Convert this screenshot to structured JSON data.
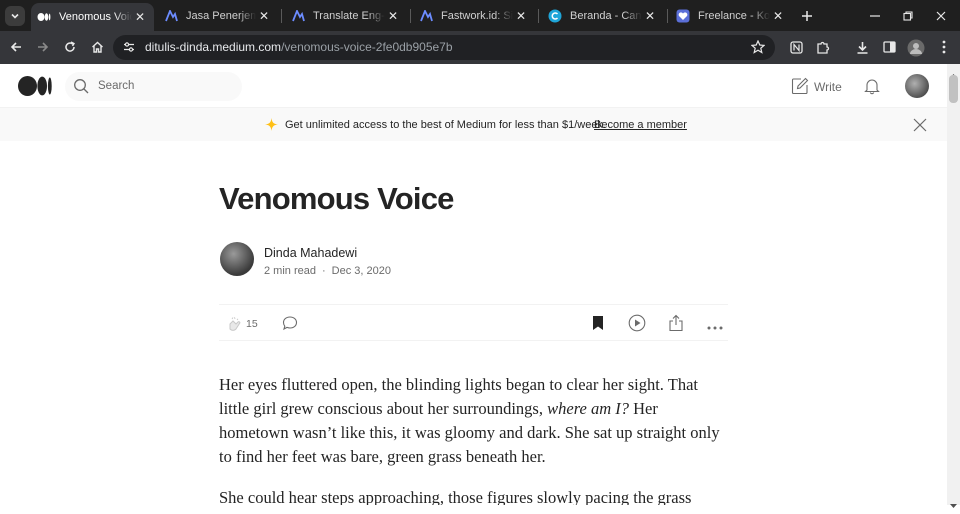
{
  "browser": {
    "tabs": [
      {
        "title": "Venomous Voice. Her eyes fluttered",
        "favicon": "medium-icon",
        "active": true
      },
      {
        "title": "Jasa Penerjemah & Translator",
        "favicon": "fastwork-icon",
        "active": false
      },
      {
        "title": "Translate Eng-Indo",
        "favicon": "fastwork-icon",
        "active": false
      },
      {
        "title": "Fastwork.id: Situs Freelance",
        "favicon": "fastwork-icon",
        "active": false
      },
      {
        "title": "Beranda - Canva",
        "favicon": "canva-icon",
        "active": false
      },
      {
        "title": "Freelance - Konten",
        "favicon": "heart-icon",
        "active": false
      }
    ],
    "url_host": "ditulis-dinda.medium.com",
    "url_path": "/venomous-voice-2fe0db905e7b"
  },
  "medium": {
    "search_placeholder": "Search",
    "write_label": "Write"
  },
  "banner": {
    "text": "Get unlimited access to the best of Medium for less than $1/week.",
    "link": "Become a member"
  },
  "article": {
    "title": "Venomous Voice",
    "author": "Dinda Mahadewi",
    "read_time": "2 min read",
    "separator": "·",
    "date": "Dec 3, 2020",
    "claps": "15",
    "paragraph1_a": "Her eyes fluttered open, the blinding lights began to clear her sight. That little girl grew conscious about her surroundings, ",
    "paragraph1_italic": "where am I?",
    "paragraph1_b": " Her hometown wasn’t like this, it was gloomy and dark. She sat up straight only to find her feet was bare, green grass beneath her.",
    "paragraph2": "She could hear steps approaching, those figures slowly pacing the grass"
  },
  "colors": {
    "tabbar_bg": "#1f1f1f",
    "toolbar_bg": "#35363a",
    "text_primary": "#242424",
    "text_secondary": "#6b6b6b",
    "banner_bg": "#f9f9f9",
    "star_accent": "#ffc017"
  }
}
